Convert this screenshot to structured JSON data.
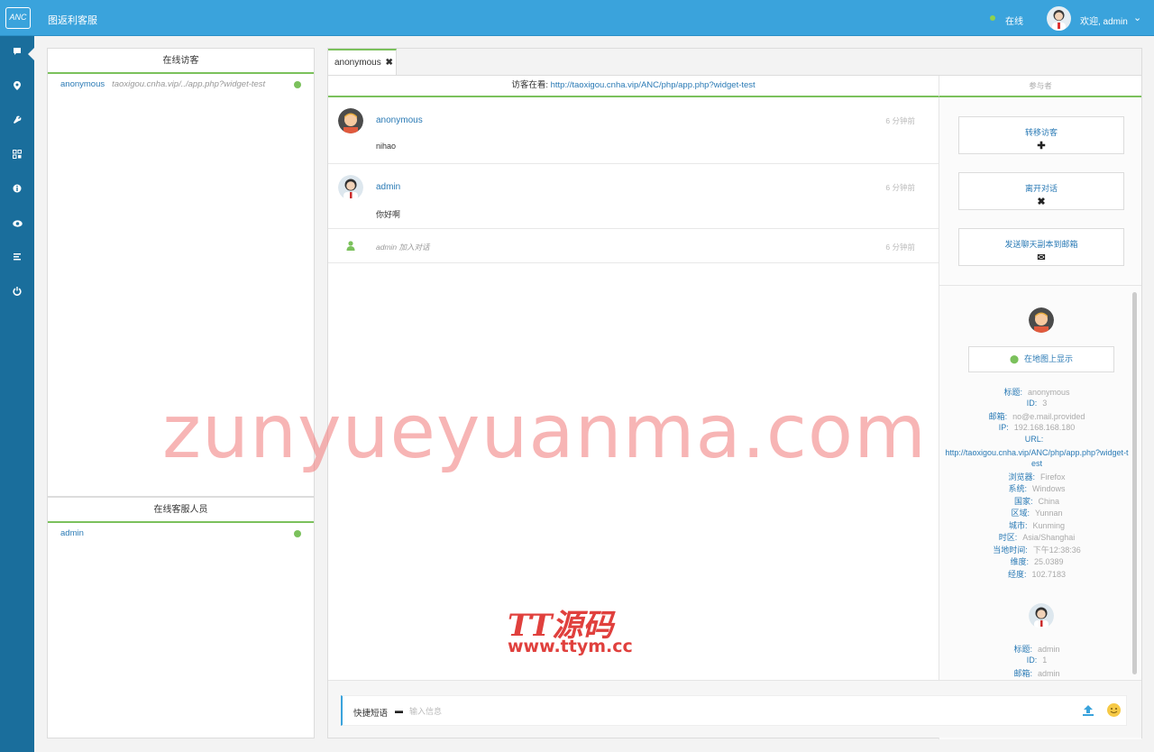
{
  "topbar": {
    "logo_text": "ANC",
    "app_title": "图返利客服",
    "status_text": "在线",
    "welcome_text": "欢迎, admin",
    "caret_icon": "chevron-down-icon"
  },
  "sidenav": {
    "items": [
      {
        "icon": "chat-icon",
        "glyph": "▪"
      },
      {
        "icon": "location-icon",
        "glyph": "⬤"
      },
      {
        "icon": "wrench-icon",
        "glyph": "✎"
      },
      {
        "icon": "qrcode-icon",
        "glyph": "▦"
      },
      {
        "icon": "info-icon",
        "glyph": "ℹ"
      },
      {
        "icon": "eye-icon",
        "glyph": "◉"
      },
      {
        "icon": "list-icon",
        "glyph": "≡"
      },
      {
        "icon": "power-icon",
        "glyph": "⏻"
      }
    ]
  },
  "visitors": {
    "title": "在线访客",
    "items": [
      {
        "name": "anonymous",
        "url": "taoxigou.cnha.vip/../app.php?widget-test"
      }
    ]
  },
  "operators": {
    "title": "在线客服人员",
    "items": [
      {
        "name": "admin"
      }
    ]
  },
  "tab": {
    "label": "anonymous",
    "close": "✖"
  },
  "viewing": {
    "label": "访客在看:",
    "url": "http://taoxigou.cnha.vip/ANC/php/app.php?widget-test"
  },
  "participants_title": "参与者",
  "messages": [
    {
      "name": "anonymous",
      "time": "6 分钟前",
      "text": "nihao"
    },
    {
      "name": "admin",
      "time": "6 分钟前",
      "text": "你好啊"
    }
  ],
  "system_message": {
    "text": "admin 加入对话",
    "time": "6 分钟前"
  },
  "actions": [
    {
      "label": "转移访客",
      "icon": "✚"
    },
    {
      "label": "离开对话",
      "icon": "✖"
    },
    {
      "label": "发送聊天副本到邮箱",
      "icon": "✉"
    }
  ],
  "map_button": "在地图上显示",
  "visitor_info": [
    {
      "key": "标题:",
      "value": "anonymous"
    },
    {
      "key": "ID:",
      "value": "3"
    },
    {
      "key": "邮箱:",
      "value": "no@e.mail.provided"
    },
    {
      "key": "IP:",
      "value": "192.168.168.180"
    },
    {
      "key": "URL:",
      "value": ""
    },
    {
      "key": "",
      "value": "http://taoxigou.cnha.vip/ANC/php/app.php?widget-test"
    },
    {
      "key": "浏览器:",
      "value": "Firefox"
    },
    {
      "key": "系统:",
      "value": "Windows"
    },
    {
      "key": "国家:",
      "value": "China"
    },
    {
      "key": "区域:",
      "value": "Yunnan"
    },
    {
      "key": "城市:",
      "value": "Kunming"
    },
    {
      "key": "时区:",
      "value": "Asia/Shanghai"
    },
    {
      "key": "当地时间:",
      "value": "下午12:38:36"
    },
    {
      "key": "维度:",
      "value": "25.0389"
    },
    {
      "key": "经度:",
      "value": "102.7183"
    }
  ],
  "operator_info": [
    {
      "key": "标题:",
      "value": "admin"
    },
    {
      "key": "ID:",
      "value": "1"
    },
    {
      "key": "邮箱:",
      "value": "admin"
    }
  ],
  "composer": {
    "quick_label": "快捷短语",
    "placeholder": "输入信息"
  },
  "watermarks": {
    "main": "zunyueyuanma.com",
    "brand": "TT源码",
    "brand_url": "www.ttym.cc"
  },
  "colors": {
    "topbar": "#3aa3dc",
    "sidenav": "#1a6e9c",
    "accent_green": "#7bc15c",
    "link": "#2a7ab5"
  }
}
